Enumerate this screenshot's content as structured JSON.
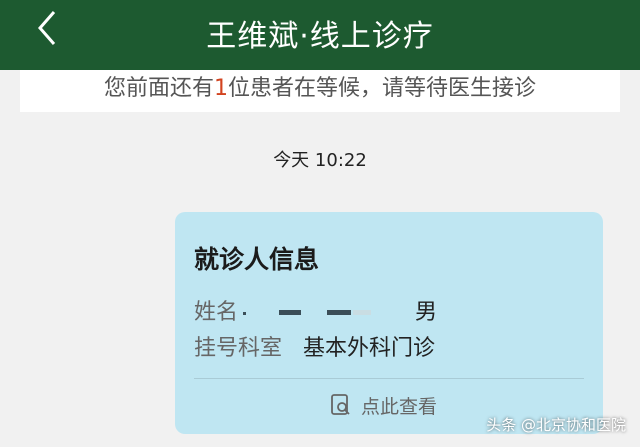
{
  "header": {
    "title": "王维斌·线上诊疗",
    "back_icon": "chevron-left-icon",
    "background_color": "#1d5a30"
  },
  "queue": {
    "prefix": "您前面还有",
    "count": "1",
    "suffix": "位患者在等候，请等待医生接诊"
  },
  "chat": {
    "timestamp": "今天 10:22"
  },
  "card": {
    "title": "就诊人信息",
    "name_label": "姓名",
    "gender": "男",
    "department_label": "挂号科室",
    "department_value": "基本外科门诊",
    "view_label": "点此查看",
    "view_icon": "search-document-icon",
    "background_color": "#bfe6f2"
  },
  "watermark": "头条 @北京协和医院"
}
